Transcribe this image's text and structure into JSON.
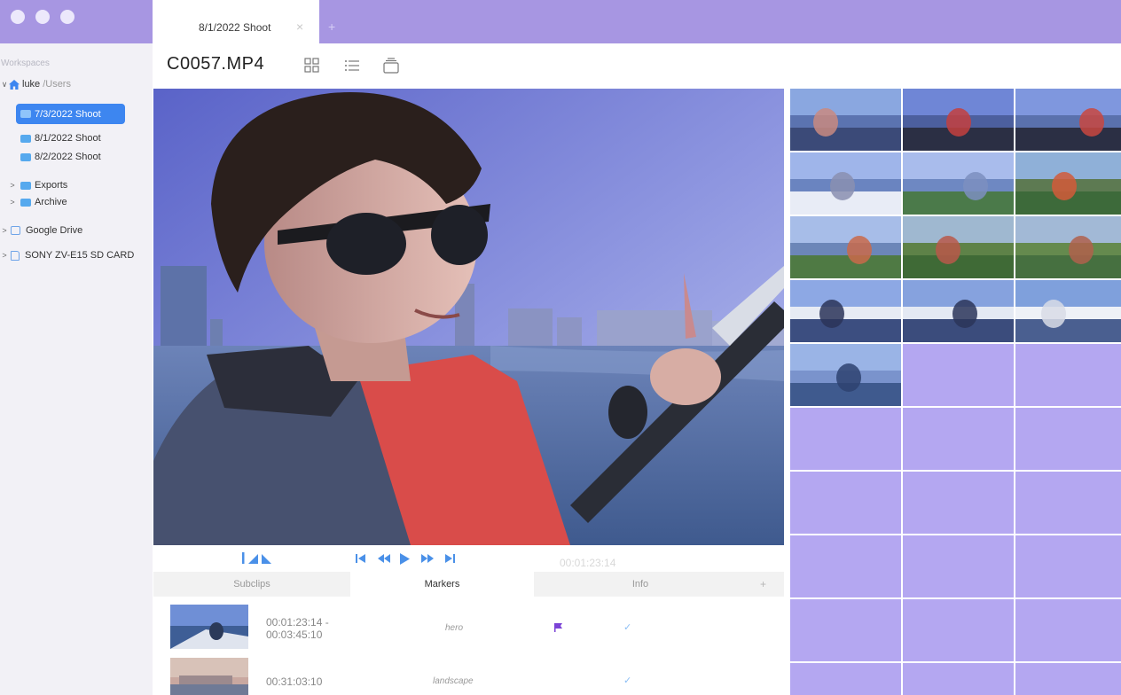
{
  "tabs": [
    {
      "label": "8/1/2022 Shoot",
      "close": "×"
    }
  ],
  "tab_add": "+",
  "sidebar": {
    "heading": "Workspaces",
    "root": {
      "user": "luke",
      "path": "/Users",
      "chevron": "∨"
    },
    "items": [
      {
        "label": "7/3/2022 Shoot",
        "selected": true
      },
      {
        "label": "8/1/2022 Shoot"
      },
      {
        "label": "8/2/2022 Shoot"
      },
      {
        "label": "Exports",
        "chevron": ">"
      },
      {
        "label": "Archive",
        "chevron": ">"
      }
    ],
    "locations": [
      {
        "label": "Google Drive",
        "chevron": ">"
      },
      {
        "label": "SONY ZV-E15 SD CARD",
        "chevron": ">"
      }
    ]
  },
  "toolbar": {
    "title": "C0057.MP4",
    "icons": [
      "grid-view-icon",
      "list-view-icon",
      "stack-view-icon"
    ]
  },
  "player": {
    "timecode": "00:01:23:14"
  },
  "panel_tabs": [
    "Subclips",
    "Markers",
    "Info"
  ],
  "active_panel": "Markers",
  "panel_add": "+",
  "markers": [
    {
      "time_start": "00:01:23:14 -",
      "time_end": "00:03:45:10",
      "label": "hero",
      "flagged": true,
      "checked": true,
      "check": "✓"
    },
    {
      "time_start": "00:31:03:10",
      "time_end": "",
      "label": "landscape",
      "flagged": false,
      "checked": true,
      "check": "✓"
    }
  ],
  "colors": {
    "accent": "#a796e2",
    "selection": "#3d86f0",
    "grid_empty": "#b4a7f1",
    "flag": "#7b43d6"
  }
}
